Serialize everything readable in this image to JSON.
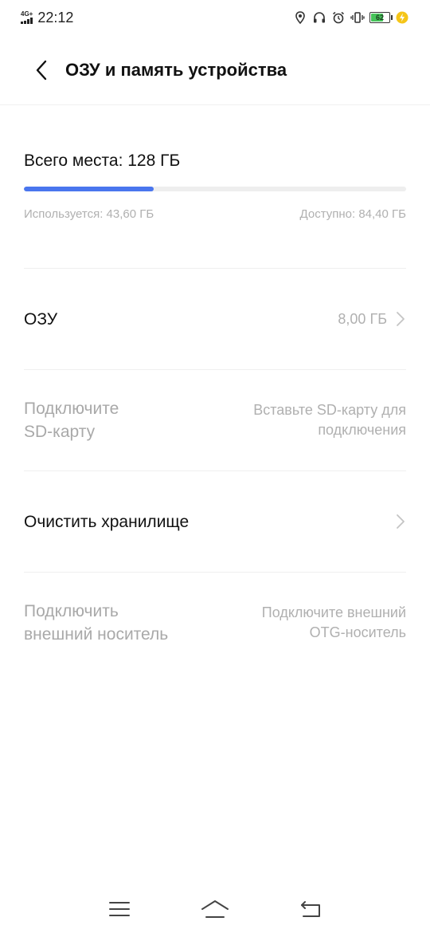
{
  "status_bar": {
    "network": "4G+",
    "time": "22:12",
    "battery": "62"
  },
  "header": {
    "title": "ОЗУ и память устройства"
  },
  "storage": {
    "total_label": "Всего места: 128 ГБ",
    "used_label": "Используется: 43,60 ГБ",
    "available_label": "Доступно: 84,40 ГБ",
    "used_fraction": 0.34,
    "accent_color": "#4a76ee"
  },
  "list": {
    "ram": {
      "title": "ОЗУ",
      "value": "8,00 ГБ"
    },
    "sd_card": {
      "title_line1": "Подключите",
      "title_line2": "SD-карту",
      "value_line1": "Вставьте SD-карту для",
      "value_line2": "подключения"
    },
    "clean": {
      "title": "Очистить хранилище"
    },
    "external": {
      "title_line1": "Подключить",
      "title_line2": "внешний носитель",
      "value_line1": "Подключите внешний",
      "value_line2": "OTG-носитель"
    }
  },
  "icons": {
    "back": "chevron-left-icon",
    "location": "location-pin-icon",
    "headphones": "headphones-icon",
    "alarm": "alarm-clock-icon",
    "vibrate": "vibrate-icon",
    "charging": "lightning-icon",
    "menu": "menu-icon",
    "home": "home-icon",
    "return": "back-arrow-icon"
  }
}
